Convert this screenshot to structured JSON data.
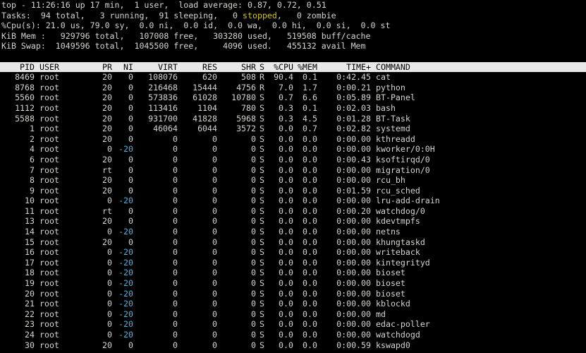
{
  "summary": {
    "line1": "top - 11:26:16 up 17 min,  1 user,  load average: 0.87, 0.72, 0.51",
    "tasks_prefix": "Tasks:  94 total,   3 running,  91 sleeping,   0 ",
    "tasks_stopped": "stopped",
    "tasks_suffix": ",   0 zombie",
    "cpu": "%Cpu(s): 21.0 us, 79.0 sy,  0.0 ni,  0.0 id,  0.0 wa,  0.0 hi,  0.0 si,  0.0 st",
    "mem": "KiB Mem :   929796 total,   107008 free,   303280 used,   519508 buff/cache",
    "swap": "KiB Swap:  1049596 total,  1045500 free,     4096 used.   455132 avail Mem"
  },
  "columns": {
    "pid": "PID",
    "user": "USER",
    "pr": "PR",
    "ni": "NI",
    "virt": "VIRT",
    "res": "RES",
    "shr": "SHR",
    "s": "S",
    "cpu": "%CPU",
    "mem": "%MEM",
    "time": "TIME+",
    "command": "COMMAND"
  },
  "colors": {
    "background": "#000000",
    "text": "#d3d7cf",
    "header_bar": "#e8e8e8",
    "stopped": "#d7c700",
    "negative_nice": "#4fb2e6"
  },
  "processes": [
    {
      "pid": "8469",
      "user": "root",
      "pr": "20",
      "ni": "0",
      "virt": "108076",
      "res": "620",
      "shr": "508",
      "s": "R",
      "cpu": "90.4",
      "mem": "0.1",
      "time": "0:42.45",
      "command": "cat"
    },
    {
      "pid": "8768",
      "user": "root",
      "pr": "20",
      "ni": "0",
      "virt": "216468",
      "res": "15444",
      "shr": "4756",
      "s": "R",
      "cpu": "7.0",
      "mem": "1.7",
      "time": "0:00.21",
      "command": "python"
    },
    {
      "pid": "5560",
      "user": "root",
      "pr": "20",
      "ni": "0",
      "virt": "573836",
      "res": "61028",
      "shr": "10780",
      "s": "S",
      "cpu": "0.7",
      "mem": "6.6",
      "time": "0:05.89",
      "command": "BT-Panel"
    },
    {
      "pid": "1112",
      "user": "root",
      "pr": "20",
      "ni": "0",
      "virt": "113416",
      "res": "1104",
      "shr": "780",
      "s": "S",
      "cpu": "0.3",
      "mem": "0.1",
      "time": "0:02.03",
      "command": "bash"
    },
    {
      "pid": "5588",
      "user": "root",
      "pr": "20",
      "ni": "0",
      "virt": "931700",
      "res": "41828",
      "shr": "5968",
      "s": "S",
      "cpu": "0.3",
      "mem": "4.5",
      "time": "0:01.28",
      "command": "BT-Task"
    },
    {
      "pid": "1",
      "user": "root",
      "pr": "20",
      "ni": "0",
      "virt": "46064",
      "res": "6044",
      "shr": "3572",
      "s": "S",
      "cpu": "0.0",
      "mem": "0.7",
      "time": "0:02.82",
      "command": "systemd"
    },
    {
      "pid": "2",
      "user": "root",
      "pr": "20",
      "ni": "0",
      "virt": "0",
      "res": "0",
      "shr": "0",
      "s": "S",
      "cpu": "0.0",
      "mem": "0.0",
      "time": "0:00.00",
      "command": "kthreadd"
    },
    {
      "pid": "4",
      "user": "root",
      "pr": "0",
      "ni": "-20",
      "virt": "0",
      "res": "0",
      "shr": "0",
      "s": "S",
      "cpu": "0.0",
      "mem": "0.0",
      "time": "0:00.00",
      "command": "kworker/0:0H"
    },
    {
      "pid": "6",
      "user": "root",
      "pr": "20",
      "ni": "0",
      "virt": "0",
      "res": "0",
      "shr": "0",
      "s": "S",
      "cpu": "0.0",
      "mem": "0.0",
      "time": "0:00.43",
      "command": "ksoftirqd/0"
    },
    {
      "pid": "7",
      "user": "root",
      "pr": "rt",
      "ni": "0",
      "virt": "0",
      "res": "0",
      "shr": "0",
      "s": "S",
      "cpu": "0.0",
      "mem": "0.0",
      "time": "0:00.00",
      "command": "migration/0"
    },
    {
      "pid": "8",
      "user": "root",
      "pr": "20",
      "ni": "0",
      "virt": "0",
      "res": "0",
      "shr": "0",
      "s": "S",
      "cpu": "0.0",
      "mem": "0.0",
      "time": "0:00.00",
      "command": "rcu_bh"
    },
    {
      "pid": "9",
      "user": "root",
      "pr": "20",
      "ni": "0",
      "virt": "0",
      "res": "0",
      "shr": "0",
      "s": "S",
      "cpu": "0.0",
      "mem": "0.0",
      "time": "0:01.59",
      "command": "rcu_sched"
    },
    {
      "pid": "10",
      "user": "root",
      "pr": "0",
      "ni": "-20",
      "virt": "0",
      "res": "0",
      "shr": "0",
      "s": "S",
      "cpu": "0.0",
      "mem": "0.0",
      "time": "0:00.00",
      "command": "lru-add-drain"
    },
    {
      "pid": "11",
      "user": "root",
      "pr": "rt",
      "ni": "0",
      "virt": "0",
      "res": "0",
      "shr": "0",
      "s": "S",
      "cpu": "0.0",
      "mem": "0.0",
      "time": "0:00.20",
      "command": "watchdog/0"
    },
    {
      "pid": "13",
      "user": "root",
      "pr": "20",
      "ni": "0",
      "virt": "0",
      "res": "0",
      "shr": "0",
      "s": "S",
      "cpu": "0.0",
      "mem": "0.0",
      "time": "0:00.00",
      "command": "kdevtmpfs"
    },
    {
      "pid": "14",
      "user": "root",
      "pr": "0",
      "ni": "-20",
      "virt": "0",
      "res": "0",
      "shr": "0",
      "s": "S",
      "cpu": "0.0",
      "mem": "0.0",
      "time": "0:00.00",
      "command": "netns"
    },
    {
      "pid": "15",
      "user": "root",
      "pr": "20",
      "ni": "0",
      "virt": "0",
      "res": "0",
      "shr": "0",
      "s": "S",
      "cpu": "0.0",
      "mem": "0.0",
      "time": "0:00.00",
      "command": "khungtaskd"
    },
    {
      "pid": "16",
      "user": "root",
      "pr": "0",
      "ni": "-20",
      "virt": "0",
      "res": "0",
      "shr": "0",
      "s": "S",
      "cpu": "0.0",
      "mem": "0.0",
      "time": "0:00.00",
      "command": "writeback"
    },
    {
      "pid": "17",
      "user": "root",
      "pr": "0",
      "ni": "-20",
      "virt": "0",
      "res": "0",
      "shr": "0",
      "s": "S",
      "cpu": "0.0",
      "mem": "0.0",
      "time": "0:00.00",
      "command": "kintegrityd"
    },
    {
      "pid": "18",
      "user": "root",
      "pr": "0",
      "ni": "-20",
      "virt": "0",
      "res": "0",
      "shr": "0",
      "s": "S",
      "cpu": "0.0",
      "mem": "0.0",
      "time": "0:00.00",
      "command": "bioset"
    },
    {
      "pid": "19",
      "user": "root",
      "pr": "0",
      "ni": "-20",
      "virt": "0",
      "res": "0",
      "shr": "0",
      "s": "S",
      "cpu": "0.0",
      "mem": "0.0",
      "time": "0:00.00",
      "command": "bioset"
    },
    {
      "pid": "20",
      "user": "root",
      "pr": "0",
      "ni": "-20",
      "virt": "0",
      "res": "0",
      "shr": "0",
      "s": "S",
      "cpu": "0.0",
      "mem": "0.0",
      "time": "0:00.00",
      "command": "bioset"
    },
    {
      "pid": "21",
      "user": "root",
      "pr": "0",
      "ni": "-20",
      "virt": "0",
      "res": "0",
      "shr": "0",
      "s": "S",
      "cpu": "0.0",
      "mem": "0.0",
      "time": "0:00.00",
      "command": "kblockd"
    },
    {
      "pid": "22",
      "user": "root",
      "pr": "0",
      "ni": "-20",
      "virt": "0",
      "res": "0",
      "shr": "0",
      "s": "S",
      "cpu": "0.0",
      "mem": "0.0",
      "time": "0:00.00",
      "command": "md"
    },
    {
      "pid": "23",
      "user": "root",
      "pr": "0",
      "ni": "-20",
      "virt": "0",
      "res": "0",
      "shr": "0",
      "s": "S",
      "cpu": "0.0",
      "mem": "0.0",
      "time": "0:00.00",
      "command": "edac-poller"
    },
    {
      "pid": "24",
      "user": "root",
      "pr": "0",
      "ni": "-20",
      "virt": "0",
      "res": "0",
      "shr": "0",
      "s": "S",
      "cpu": "0.0",
      "mem": "0.0",
      "time": "0:00.00",
      "command": "watchdogd"
    },
    {
      "pid": "30",
      "user": "root",
      "pr": "20",
      "ni": "0",
      "virt": "0",
      "res": "0",
      "shr": "0",
      "s": "S",
      "cpu": "0.0",
      "mem": "0.0",
      "time": "0:00.59",
      "command": "kswapd0"
    }
  ]
}
